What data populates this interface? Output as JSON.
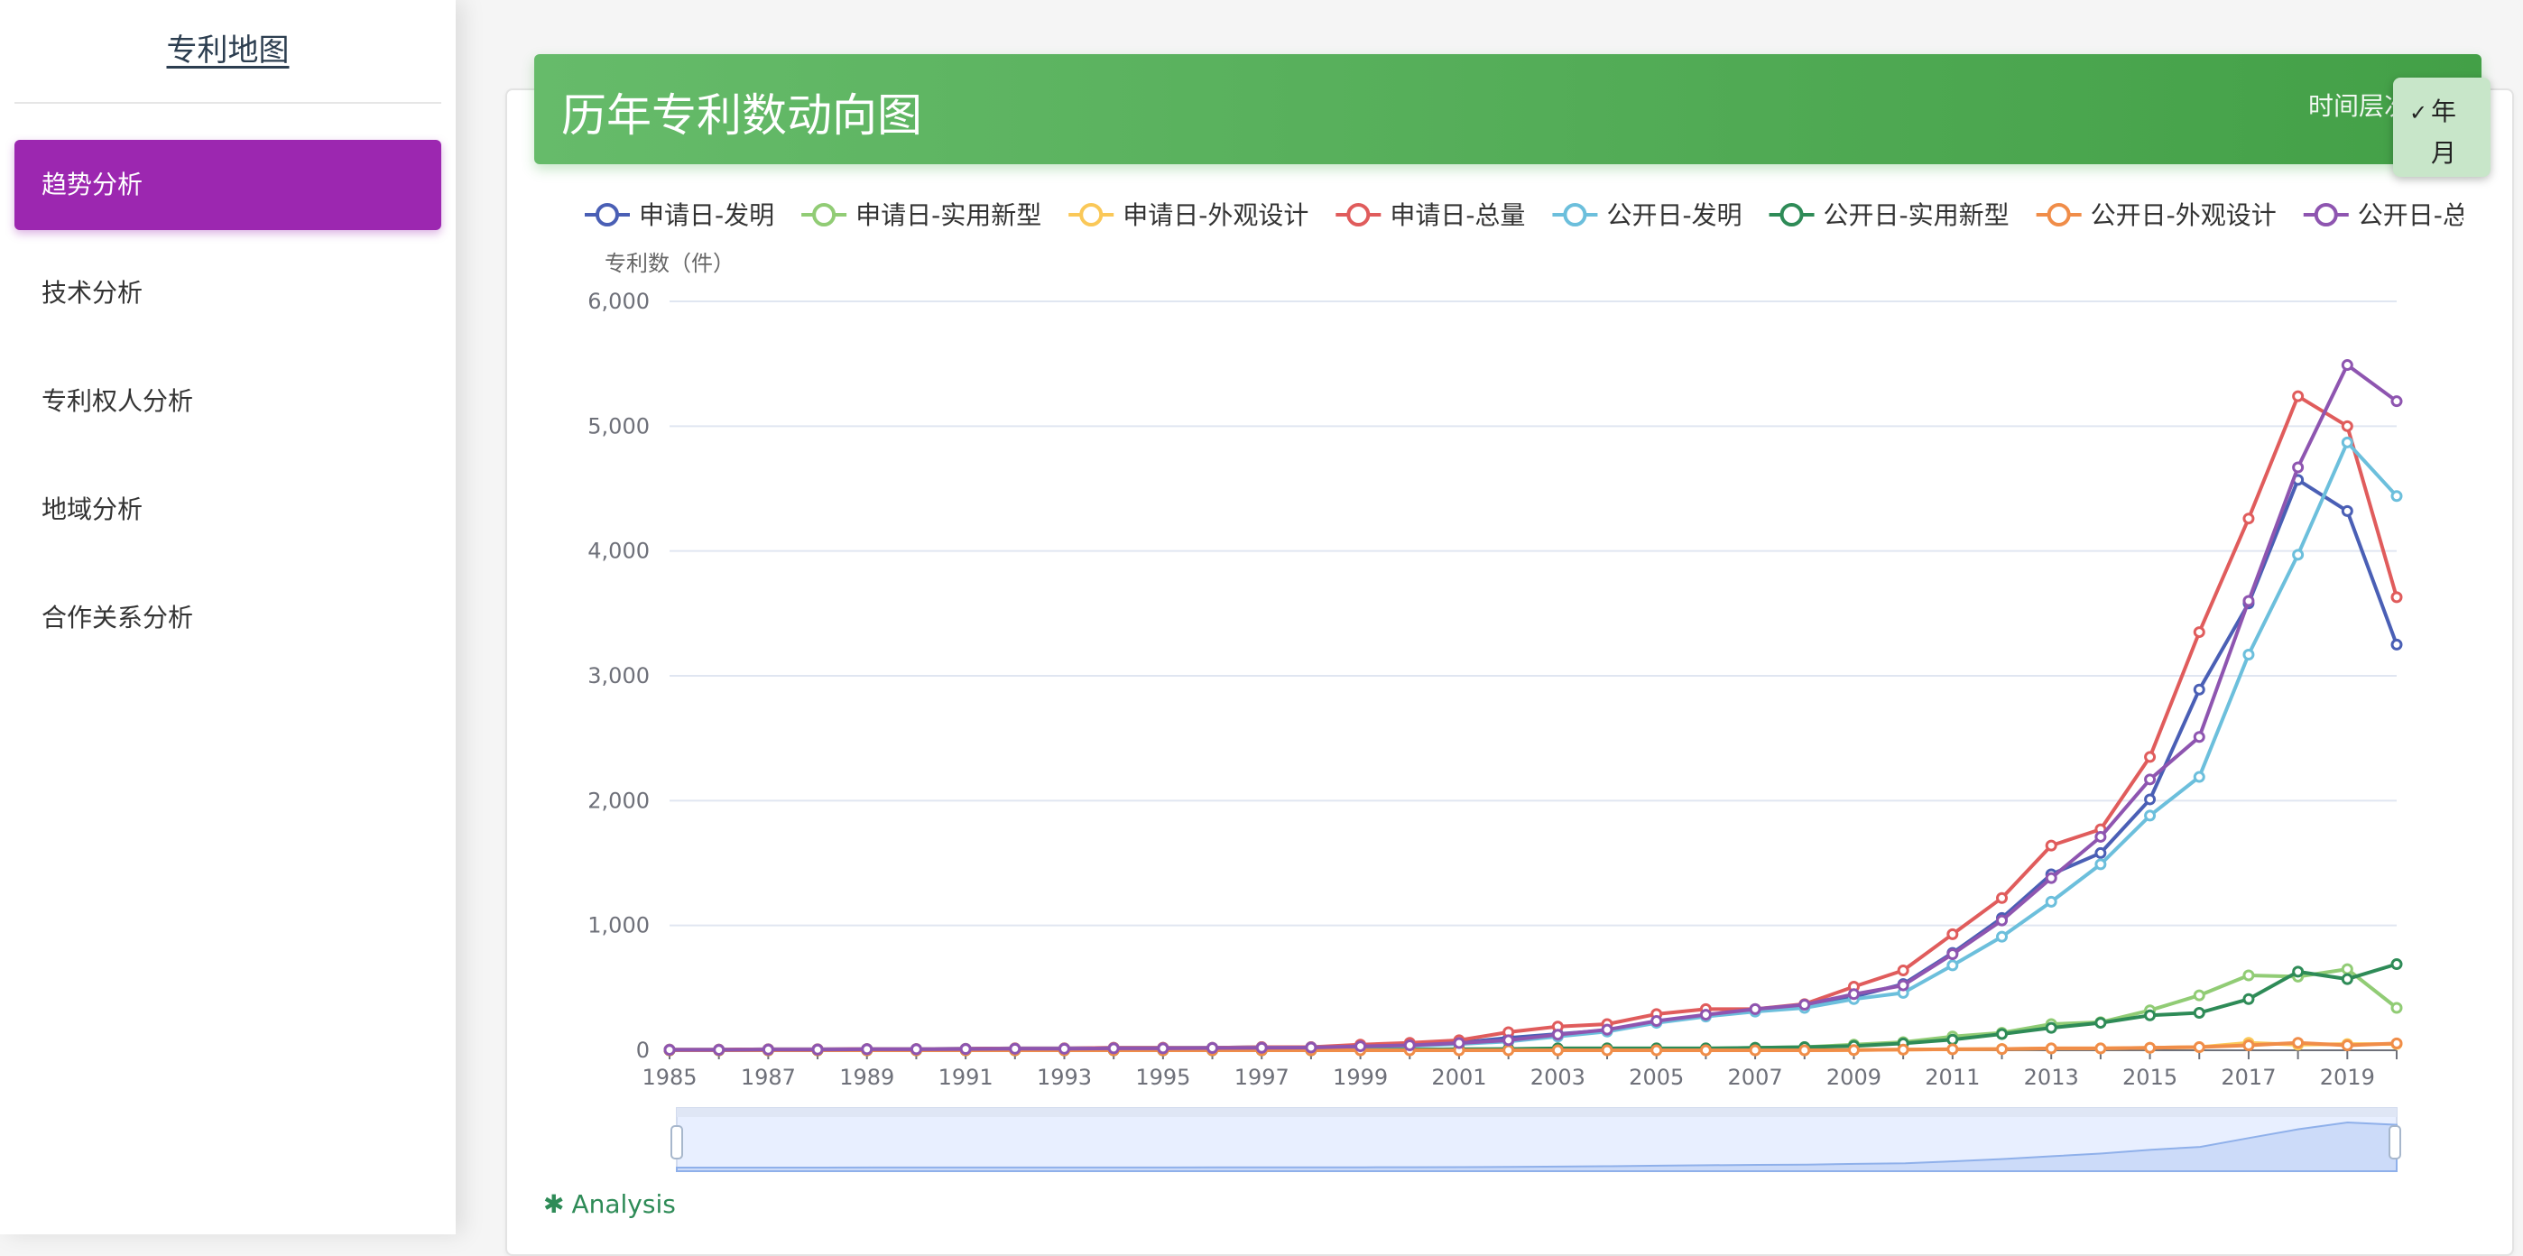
{
  "sidebar": {
    "brand": "专利地图",
    "items": [
      {
        "label": "趋势分析",
        "active": true
      },
      {
        "label": "技术分析",
        "active": false
      },
      {
        "label": "专利权人分析",
        "active": false
      },
      {
        "label": "地域分析",
        "active": false
      },
      {
        "label": "合作关系分析",
        "active": false
      }
    ]
  },
  "header": {
    "title": "历年专利数动向图",
    "time_label": "时间层次",
    "options": [
      {
        "label": "年",
        "checked": true
      },
      {
        "label": "月",
        "checked": false
      }
    ],
    "check_icon": "checkmark-icon"
  },
  "footer": {
    "analysis_icon": "asterisk-icon",
    "analysis_label": "Analysis"
  },
  "colors": {
    "accent_purple": "#9c27b0",
    "header_green": "#4caf50",
    "analysis_green": "#2e8b57"
  },
  "chart_data": {
    "type": "line",
    "ylabel": "专利数（件）",
    "ylim": [
      0,
      6000
    ],
    "yticks": [
      0,
      1000,
      2000,
      3000,
      4000,
      5000,
      6000
    ],
    "ytick_labels": [
      "0",
      "1,000",
      "2,000",
      "3,000",
      "4,000",
      "5,000",
      "6,000"
    ],
    "x": [
      1985,
      1986,
      1987,
      1988,
      1989,
      1990,
      1991,
      1992,
      1993,
      1994,
      1995,
      1996,
      1997,
      1998,
      1999,
      2000,
      2001,
      2002,
      2003,
      2004,
      2005,
      2006,
      2007,
      2008,
      2009,
      2010,
      2011,
      2012,
      2013,
      2014,
      2015,
      2016,
      2017,
      2018,
      2019,
      2020
    ],
    "xtick_labels": [
      "1985",
      "1987",
      "1989",
      "1991",
      "1993",
      "1995",
      "1997",
      "1999",
      "2001",
      "2003",
      "2005",
      "2007",
      "2009",
      "2011",
      "2013",
      "2015",
      "2017",
      "2019"
    ],
    "grid": true,
    "legend_position": "top",
    "has_data_zoom": true,
    "series": [
      {
        "name": "申请日-发明",
        "color": "#4a5fb5",
        "values": [
          5,
          5,
          8,
          8,
          10,
          10,
          12,
          15,
          15,
          20,
          20,
          20,
          25,
          25,
          35,
          45,
          60,
          100,
          130,
          160,
          230,
          280,
          320,
          360,
          430,
          530,
          780,
          1060,
          1410,
          1580,
          2010,
          2890,
          3580,
          4570,
          4320,
          3250
        ]
      },
      {
        "name": "申请日-实用新型",
        "color": "#91cc75",
        "values": [
          0,
          0,
          0,
          0,
          0,
          0,
          0,
          0,
          0,
          0,
          0,
          0,
          0,
          0,
          2,
          5,
          8,
          10,
          15,
          15,
          15,
          15,
          20,
          25,
          45,
          65,
          110,
          140,
          210,
          225,
          320,
          440,
          600,
          590,
          650,
          340
        ]
      },
      {
        "name": "申请日-外观设计",
        "color": "#fac858",
        "values": [
          0,
          0,
          0,
          0,
          0,
          0,
          0,
          0,
          0,
          0,
          0,
          0,
          0,
          0,
          0,
          0,
          0,
          0,
          0,
          0,
          0,
          0,
          0,
          0,
          2,
          5,
          8,
          10,
          15,
          15,
          20,
          25,
          60,
          45,
          50,
          50
        ]
      },
      {
        "name": "申请日-总量",
        "color": "#e05c5c",
        "values": [
          5,
          5,
          8,
          8,
          10,
          10,
          12,
          15,
          15,
          20,
          20,
          20,
          25,
          25,
          45,
          60,
          80,
          145,
          190,
          210,
          290,
          330,
          330,
          370,
          510,
          640,
          930,
          1220,
          1640,
          1770,
          2350,
          3350,
          4260,
          5240,
          5000,
          3630
        ]
      },
      {
        "name": "公开日-发明",
        "color": "#6cbfdc",
        "values": [
          3,
          3,
          5,
          5,
          8,
          8,
          10,
          12,
          12,
          15,
          15,
          18,
          20,
          22,
          30,
          35,
          50,
          70,
          110,
          150,
          220,
          270,
          310,
          340,
          410,
          460,
          680,
          910,
          1190,
          1490,
          1880,
          2190,
          3170,
          3970,
          4870,
          4440
        ]
      },
      {
        "name": "公开日-实用新型",
        "color": "#2e8b57",
        "values": [
          0,
          0,
          0,
          0,
          0,
          0,
          0,
          0,
          0,
          0,
          0,
          0,
          0,
          0,
          2,
          5,
          8,
          10,
          15,
          15,
          15,
          15,
          20,
          25,
          35,
          55,
          85,
          130,
          180,
          220,
          280,
          300,
          410,
          630,
          570,
          690
        ]
      },
      {
        "name": "公开日-外观设计",
        "color": "#f08d49",
        "values": [
          0,
          0,
          0,
          0,
          0,
          0,
          0,
          0,
          0,
          0,
          0,
          0,
          0,
          0,
          0,
          0,
          0,
          0,
          0,
          0,
          0,
          0,
          0,
          0,
          2,
          5,
          8,
          10,
          15,
          15,
          20,
          25,
          40,
          60,
          40,
          55
        ]
      },
      {
        "name": "公开日-总量",
        "color": "#8e55b0",
        "values": [
          3,
          3,
          5,
          5,
          8,
          8,
          10,
          12,
          12,
          15,
          15,
          18,
          20,
          22,
          32,
          40,
          58,
          80,
          125,
          165,
          235,
          285,
          330,
          365,
          450,
          520,
          770,
          1040,
          1380,
          1710,
          2170,
          2510,
          3600,
          4670,
          5490,
          5200
        ]
      }
    ]
  }
}
